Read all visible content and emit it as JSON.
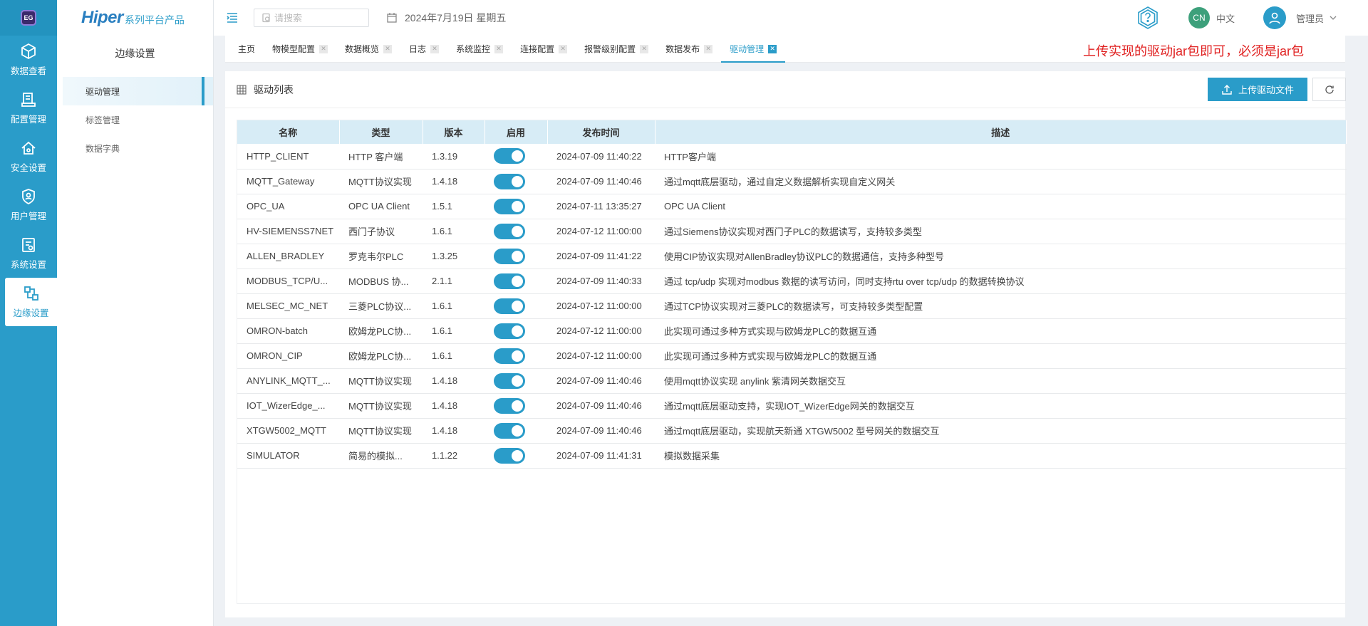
{
  "app": {
    "logo_text": "EG",
    "brand_main": "Hiper",
    "brand_sub": "系列平台产品"
  },
  "rail": {
    "items": [
      {
        "label": "数据查看",
        "icon": "data-view-icon"
      },
      {
        "label": "配置管理",
        "icon": "config-icon"
      },
      {
        "label": "安全设置",
        "icon": "security-icon"
      },
      {
        "label": "用户管理",
        "icon": "user-shield-icon"
      },
      {
        "label": "系统设置",
        "icon": "system-icon"
      },
      {
        "label": "边缘设置",
        "icon": "edge-icon",
        "active": true
      }
    ]
  },
  "sidebar": {
    "title": "边缘设置",
    "items": [
      {
        "label": "驱动管理",
        "active": true
      },
      {
        "label": "标签管理"
      },
      {
        "label": "数据字典"
      }
    ]
  },
  "header": {
    "search_placeholder": "请搜索",
    "date": "2024年7月19日 星期五",
    "lang_badge": "CN",
    "lang_label": "中文",
    "user_label": "管理员"
  },
  "tabs": [
    {
      "label": "主页",
      "closable": false
    },
    {
      "label": "物模型配置",
      "closable": true
    },
    {
      "label": "数据概览",
      "closable": true
    },
    {
      "label": "日志",
      "closable": true
    },
    {
      "label": "系统监控",
      "closable": true
    },
    {
      "label": "连接配置",
      "closable": true
    },
    {
      "label": "报警级别配置",
      "closable": true
    },
    {
      "label": "数据发布",
      "closable": true
    },
    {
      "label": "驱动管理",
      "closable": true,
      "active": true
    }
  ],
  "annotation": "上传实现的驱动jar包即可，必须是jar包",
  "annotation_color": "#e02020",
  "accent_color": "#2a9cc9",
  "panel": {
    "title": "驱动列表",
    "upload_label": "上传驱动文件",
    "columns": [
      "名称",
      "类型",
      "版本",
      "启用",
      "发布时间",
      "描述"
    ],
    "rows": [
      {
        "name": "HTTP_CLIENT",
        "type": "HTTP 客户端",
        "version": "1.3.19",
        "enabled": true,
        "time": "2024-07-09 11:40:22",
        "desc": "HTTP客户端"
      },
      {
        "name": "MQTT_Gateway",
        "type": "MQTT协议实现",
        "version": "1.4.18",
        "enabled": true,
        "time": "2024-07-09 11:40:46",
        "desc": "通过mqtt底层驱动，通过自定义数据解析实现自定义网关"
      },
      {
        "name": "OPC_UA",
        "type": "OPC UA Client",
        "version": "1.5.1",
        "enabled": true,
        "time": "2024-07-11 13:35:27",
        "desc": "OPC UA Client"
      },
      {
        "name": "HV-SIEMENSS7NET",
        "type": "西门子协议",
        "version": "1.6.1",
        "enabled": true,
        "time": "2024-07-12 11:00:00",
        "desc": "通过Siemens协议实现对西门子PLC的数据读写，支持较多类型"
      },
      {
        "name": "ALLEN_BRADLEY",
        "type": "罗克韦尔PLC",
        "version": "1.3.25",
        "enabled": true,
        "time": "2024-07-09 11:41:22",
        "desc": "使用CIP协议实现对AllenBradley协议PLC的数据通信，支持多种型号"
      },
      {
        "name": "MODBUS_TCP/U...",
        "type": "MODBUS 协...",
        "version": "2.1.1",
        "enabled": true,
        "time": "2024-07-09 11:40:33",
        "desc": "通过 tcp/udp 实现对modbus 数据的读写访问，同时支持rtu over tcp/udp 的数据转换协议"
      },
      {
        "name": "MELSEC_MC_NET",
        "type": "三菱PLC协议...",
        "version": "1.6.1",
        "enabled": true,
        "time": "2024-07-12 11:00:00",
        "desc": "通过TCP协议实现对三菱PLC的数据读写，可支持较多类型配置"
      },
      {
        "name": "OMRON-batch",
        "type": "欧姆龙PLC协...",
        "version": "1.6.1",
        "enabled": true,
        "time": "2024-07-12 11:00:00",
        "desc": "此实现可通过多种方式实现与欧姆龙PLC的数据互通"
      },
      {
        "name": "OMRON_CIP",
        "type": "欧姆龙PLC协...",
        "version": "1.6.1",
        "enabled": true,
        "time": "2024-07-12 11:00:00",
        "desc": "此实现可通过多种方式实现与欧姆龙PLC的数据互通"
      },
      {
        "name": "ANYLINK_MQTT_...",
        "type": "MQTT协议实现",
        "version": "1.4.18",
        "enabled": true,
        "time": "2024-07-09 11:40:46",
        "desc": "使用mqtt协议实现 anylink 紫清网关数据交互"
      },
      {
        "name": "IOT_WizerEdge_...",
        "type": "MQTT协议实现",
        "version": "1.4.18",
        "enabled": true,
        "time": "2024-07-09 11:40:46",
        "desc": "通过mqtt底层驱动支持，实现IOT_WizerEdge网关的数据交互"
      },
      {
        "name": "XTGW5002_MQTT",
        "type": "MQTT协议实现",
        "version": "1.4.18",
        "enabled": true,
        "time": "2024-07-09 11:40:46",
        "desc": "通过mqtt底层驱动，实现航天新通 XTGW5002 型号网关的数据交互"
      },
      {
        "name": "SIMULATOR",
        "type": "简易的模拟...",
        "version": "1.1.22",
        "enabled": true,
        "time": "2024-07-09 11:41:31",
        "desc": "模拟数据采集"
      }
    ]
  }
}
